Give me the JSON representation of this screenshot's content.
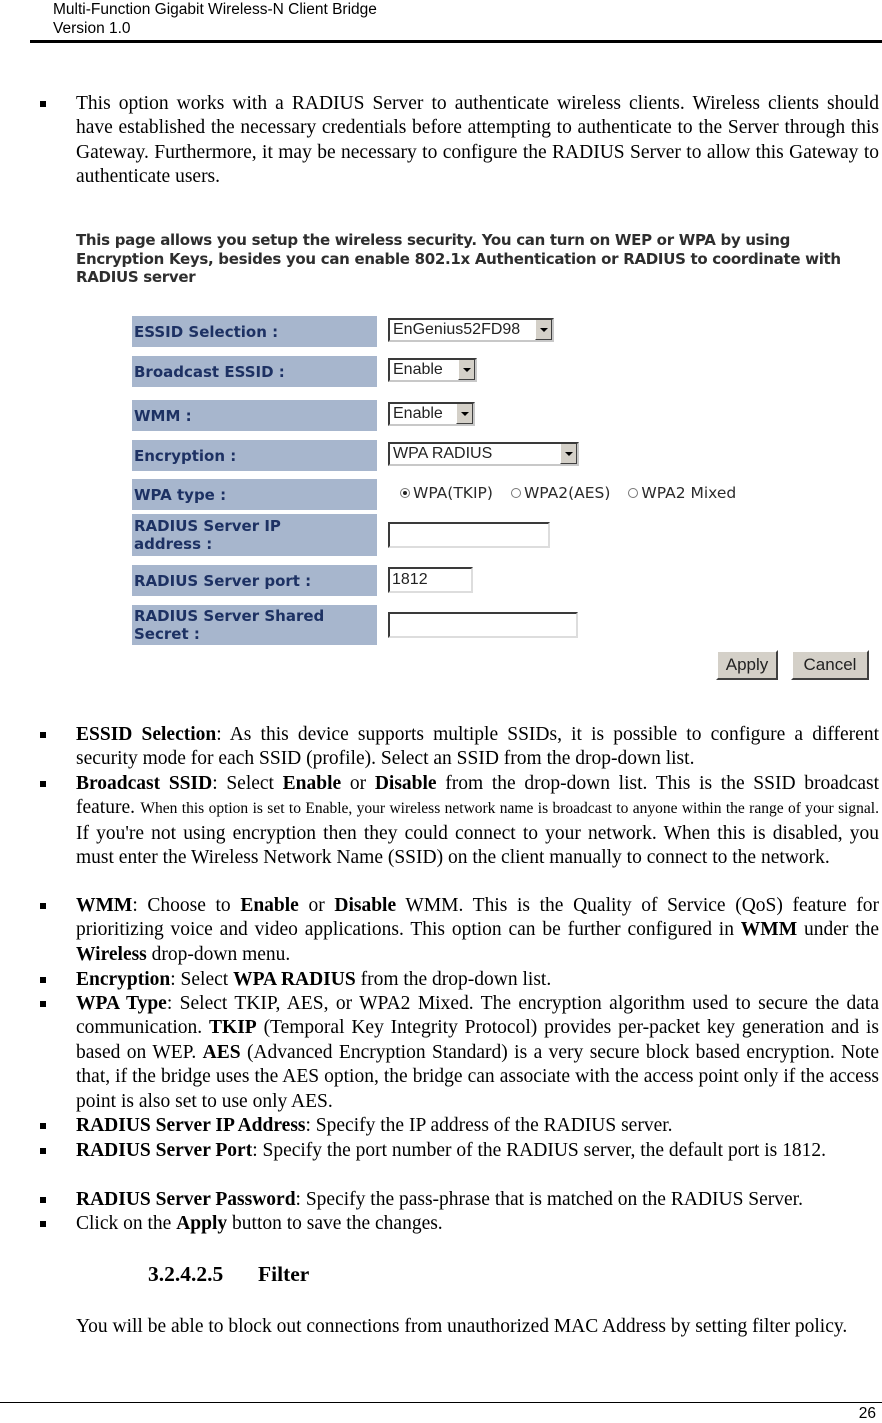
{
  "header": {
    "title": "Multi-Function Gigabit Wireless-N Client Bridge",
    "version": "Version 1.0"
  },
  "intro_bullet": "This option works with a RADIUS Server to authenticate wireless clients. Wireless clients should have established the necessary credentials before attempting to authenticate to the Server through this Gateway. Furthermore, it may be necessary to configure the RADIUS Server to allow this Gateway to authenticate users.",
  "screenshot": {
    "intro": "This page allows you setup the wireless security. You can turn on WEP or WPA by using Encryption Keys, besides you can enable 802.1x Authentication or RADIUS to coordinate with RADIUS server",
    "label_bg": "#a7b6cd",
    "label_color": "#1d3163",
    "fields": {
      "essid_selection": {
        "label": "ESSID Selection :",
        "value": "EnGenius52FD98"
      },
      "broadcast_essid": {
        "label": "Broadcast ESSID :",
        "value": "Enable"
      },
      "wmm": {
        "label": "WMM :",
        "value": "Enable"
      },
      "encryption": {
        "label": "Encryption :",
        "value": "WPA RADIUS"
      },
      "wpa_type": {
        "label": "WPA type :",
        "options": [
          "WPA(TKIP)",
          "WPA2(AES)",
          "WPA2 Mixed"
        ],
        "selected": "WPA(TKIP)"
      },
      "radius_ip": {
        "label_line1": "RADIUS Server IP",
        "label_line2": "address :",
        "value": ""
      },
      "radius_port": {
        "label": "RADIUS Server port :",
        "value": "1812"
      },
      "radius_secret": {
        "label_line1": "RADIUS Server Shared",
        "label_line2": "Secret :",
        "value": ""
      }
    },
    "buttons": {
      "apply": "Apply",
      "cancel": "Cancel"
    }
  },
  "bullets": {
    "essid": {
      "term": "ESSID Selection",
      "text": ": As this device supports multiple SSIDs, it is possible to configure a different security mode for each SSID (profile). Select an SSID from the drop-down list."
    },
    "broadcast": {
      "term": "Broadcast SSID",
      "t1": ": Select ",
      "b1": "Enable",
      "t2": " or ",
      "b2": "Disable",
      "t3": " from the drop-down list. This is the SSID broadcast feature. ",
      "small": "When this option is set to Enable, your wireless network name is broadcast to anyone within the range of your signal.",
      "t4": " If you're not using encryption then they could connect to your network. When this is disabled, you must enter the Wireless Network Name (SSID) on the client manually to connect to the network."
    },
    "wmm": {
      "term": "WMM",
      "t1": ": Choose to ",
      "b1": "Enable",
      "t2": " or ",
      "b2": "Disable",
      "t3": " WMM. This is the Quality of Service (QoS) feature for prioritizing voice and video applications. This option can be further configured in ",
      "b3": "WMM",
      "t4": " under the ",
      "b4": "Wireless",
      "t5": " drop-down menu."
    },
    "encryption": {
      "term": "Encryption",
      "t1": ": Select ",
      "b1": "WPA RADIUS",
      "t2": " from the drop-down list."
    },
    "wpa_type": {
      "term": "WPA Type",
      "t1": ": Select TKIP, AES, or WPA2 Mixed. The encryption algorithm used to secure the data communication. ",
      "b1": "TKIP",
      "t2": " (Temporal Key Integrity Protocol) provides per-packet key generation and is based on WEP. ",
      "b2": "AES",
      "t3": " (Advanced Encryption Standard) is a very secure block based encryption. Note that, if the bridge uses the AES option, the bridge can associate with the access point only if the access point is also set to use only AES."
    },
    "radius_ip": {
      "term": "RADIUS Server IP Address",
      "text": ": Specify the IP address of the RADIUS server."
    },
    "radius_port": {
      "term": "RADIUS Server Port",
      "text": ": Specify the port number of the RADIUS server, the default port is 1812."
    },
    "radius_pw": {
      "term": "RADIUS Server Password",
      "text": ": Specify the pass-phrase that is matched on the RADIUS Server."
    },
    "apply": {
      "t1": "Click on the ",
      "b1": "Apply",
      "t2": " button to save the changes."
    }
  },
  "section": {
    "number": "3.2.4.2.5",
    "title": "Filter"
  },
  "section_text": "You will be able to block out connections from unauthorized MAC Address by setting filter policy.",
  "page_number": "26"
}
